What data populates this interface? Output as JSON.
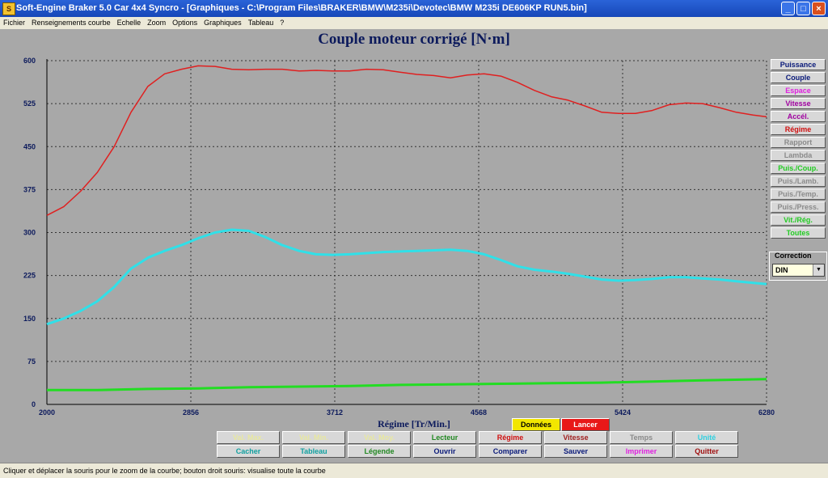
{
  "window": {
    "title": "Soft-Engine Braker 5.0 Car 4x4 Syncro - [Graphiques - C:\\Program Files\\BRAKER\\BMW\\M235i\\Devotec\\BMW M235i DE606KP RUN5.bin]",
    "minimize": "_",
    "maximize": "□",
    "close": "×"
  },
  "menu": [
    "Fichier",
    "Renseignements courbe",
    "Echelle",
    "Zoom",
    "Options",
    "Graphiques",
    "Tableau",
    "?"
  ],
  "chart_data": {
    "type": "line",
    "title": "Couple moteur corrigé [N·m]",
    "xlabel": "Régime [Tr/Min.]",
    "ylabel": "",
    "xlim": [
      2000,
      6280
    ],
    "ylim": [
      0,
      600
    ],
    "x_ticks": [
      "2000",
      "2856",
      "3712",
      "4568",
      "5424",
      "6280"
    ],
    "y_ticks": [
      "600",
      "525",
      "450",
      "375",
      "300",
      "225",
      "150",
      "75",
      "0"
    ],
    "grid": true,
    "series": [
      {
        "color": "#e02020",
        "points": [
          [
            2000,
            330
          ],
          [
            2100,
            345
          ],
          [
            2200,
            372
          ],
          [
            2300,
            405
          ],
          [
            2400,
            450
          ],
          [
            2500,
            510
          ],
          [
            2600,
            555
          ],
          [
            2700,
            577
          ],
          [
            2800,
            585
          ],
          [
            2900,
            591
          ],
          [
            3000,
            590
          ],
          [
            3100,
            585
          ],
          [
            3200,
            584
          ],
          [
            3300,
            585
          ],
          [
            3400,
            585
          ],
          [
            3500,
            582
          ],
          [
            3600,
            583
          ],
          [
            3700,
            582
          ],
          [
            3800,
            582
          ],
          [
            3900,
            585
          ],
          [
            4000,
            584
          ],
          [
            4100,
            580
          ],
          [
            4200,
            576
          ],
          [
            4300,
            574
          ],
          [
            4400,
            570
          ],
          [
            4500,
            575
          ],
          [
            4600,
            577
          ],
          [
            4700,
            573
          ],
          [
            4800,
            562
          ],
          [
            4900,
            548
          ],
          [
            5000,
            537
          ],
          [
            5100,
            531
          ],
          [
            5200,
            521
          ],
          [
            5300,
            510
          ],
          [
            5400,
            508
          ],
          [
            5500,
            508
          ],
          [
            5600,
            513
          ],
          [
            5700,
            523
          ],
          [
            5800,
            526
          ],
          [
            5900,
            525
          ],
          [
            6000,
            518
          ],
          [
            6100,
            510
          ],
          [
            6200,
            505
          ],
          [
            6280,
            502
          ]
        ]
      },
      {
        "color": "#30e0e8",
        "points": [
          [
            2000,
            140
          ],
          [
            2100,
            150
          ],
          [
            2200,
            163
          ],
          [
            2300,
            180
          ],
          [
            2400,
            205
          ],
          [
            2500,
            237
          ],
          [
            2600,
            256
          ],
          [
            2700,
            268
          ],
          [
            2800,
            278
          ],
          [
            2900,
            290
          ],
          [
            3000,
            300
          ],
          [
            3100,
            305
          ],
          [
            3200,
            303
          ],
          [
            3300,
            292
          ],
          [
            3400,
            278
          ],
          [
            3500,
            268
          ],
          [
            3600,
            262
          ],
          [
            3700,
            261
          ],
          [
            3800,
            262
          ],
          [
            3900,
            264
          ],
          [
            4000,
            266
          ],
          [
            4100,
            267
          ],
          [
            4200,
            268
          ],
          [
            4300,
            269
          ],
          [
            4400,
            270
          ],
          [
            4500,
            268
          ],
          [
            4600,
            262
          ],
          [
            4700,
            252
          ],
          [
            4800,
            241
          ],
          [
            4900,
            235
          ],
          [
            5000,
            232
          ],
          [
            5100,
            228
          ],
          [
            5200,
            223
          ],
          [
            5300,
            218
          ],
          [
            5400,
            216
          ],
          [
            5500,
            217
          ],
          [
            5600,
            219
          ],
          [
            5700,
            222
          ],
          [
            5800,
            222
          ],
          [
            5900,
            220
          ],
          [
            6000,
            218
          ],
          [
            6100,
            215
          ],
          [
            6200,
            212
          ],
          [
            6280,
            210
          ]
        ]
      },
      {
        "color": "#22dd22",
        "points": [
          [
            2000,
            25
          ],
          [
            2300,
            25
          ],
          [
            2600,
            27
          ],
          [
            2900,
            28
          ],
          [
            3200,
            30
          ],
          [
            3500,
            31
          ],
          [
            3800,
            32
          ],
          [
            4100,
            34
          ],
          [
            4400,
            35
          ],
          [
            4700,
            36
          ],
          [
            5000,
            37
          ],
          [
            5300,
            38
          ],
          [
            5600,
            40
          ],
          [
            5900,
            42
          ],
          [
            6280,
            44
          ]
        ]
      }
    ]
  },
  "right_panel": {
    "buttons": [
      {
        "label": "Puissance",
        "color": "#0a1a7a"
      },
      {
        "label": "Couple",
        "color": "#0a1a7a"
      },
      {
        "label": "Espace",
        "color": "#e020e0"
      },
      {
        "label": "Vitesse",
        "color": "#a000a0"
      },
      {
        "label": "Accél.",
        "color": "#a000a0"
      },
      {
        "label": "Régime",
        "color": "#d01010"
      },
      {
        "label": "Rapport",
        "color": "#8a8a8a"
      },
      {
        "label": "Lambda",
        "color": "#8a8a8a"
      },
      {
        "label": "Puis./Coup.",
        "color": "#22cc22"
      },
      {
        "label": "Puis./Lamb.",
        "color": "#8a8a8a"
      },
      {
        "label": "Puis./Temp.",
        "color": "#8a8a8a"
      },
      {
        "label": "Puis./Press.",
        "color": "#8a8a8a"
      },
      {
        "label": "Vit./Rég.",
        "color": "#22cc22"
      },
      {
        "label": "Toutes",
        "color": "#22cc22"
      }
    ],
    "correction_label": "Correction",
    "correction_value": "DIN"
  },
  "bottom": {
    "donnees": "Données",
    "lancer": "Lancer",
    "row1": [
      {
        "label": "Val. Max.",
        "color": "#e8e8a0"
      },
      {
        "label": "Val. Min.",
        "color": "#e8e8a0"
      },
      {
        "label": "Val. Moy.",
        "color": "#e8e8a0"
      },
      {
        "label": "Lecteur",
        "color": "#228822"
      },
      {
        "label": "Régime",
        "color": "#d01010"
      },
      {
        "label": "Vitesse",
        "color": "#a02020"
      },
      {
        "label": "Temps",
        "color": "#8a8a8a"
      },
      {
        "label": "Unité",
        "color": "#30d0e0"
      }
    ],
    "row2": [
      {
        "label": "Cacher",
        "color": "#10a0a0"
      },
      {
        "label": "Tableau",
        "color": "#10a0a0"
      },
      {
        "label": "Légende",
        "color": "#228822"
      },
      {
        "label": "Ouvrir",
        "color": "#0a1a7a"
      },
      {
        "label": "Comparer",
        "color": "#0a1a7a"
      },
      {
        "label": "Sauver",
        "color": "#0a1a7a"
      },
      {
        "label": "Imprimer",
        "color": "#e020e0"
      },
      {
        "label": "Quitter",
        "color": "#a01010"
      }
    ]
  },
  "status": "Cliquer et déplacer la souris pour le zoom de la courbe; bouton droit souris: visualise toute la courbe"
}
